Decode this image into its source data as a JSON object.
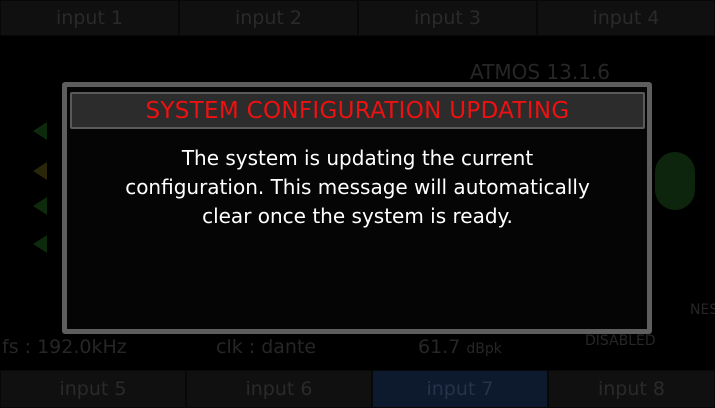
{
  "tabs_top": [
    "input 1",
    "input 2",
    "input 3",
    "input 4"
  ],
  "tabs_bottom": [
    "input 5",
    "input 6",
    "input 7",
    "input 8"
  ],
  "status": {
    "format": "ATMOS 13.1.6",
    "sample_rate": "fs : 192.0kHz",
    "clock": "clk : dante",
    "level": "61.7",
    "level_unit": "dBpk",
    "right_label": "DISABLED",
    "right_label_2": "NES"
  },
  "dialog": {
    "title": "SYSTEM CONFIGURATION UPDATING",
    "lines": [
      "The system is updating the current",
      "configuration. This message will automatically",
      "clear once the system is ready."
    ]
  },
  "colors": {
    "title_text": "#ee1111",
    "message_text": "#ffffff",
    "dialog_border": "#5e5e5e"
  }
}
